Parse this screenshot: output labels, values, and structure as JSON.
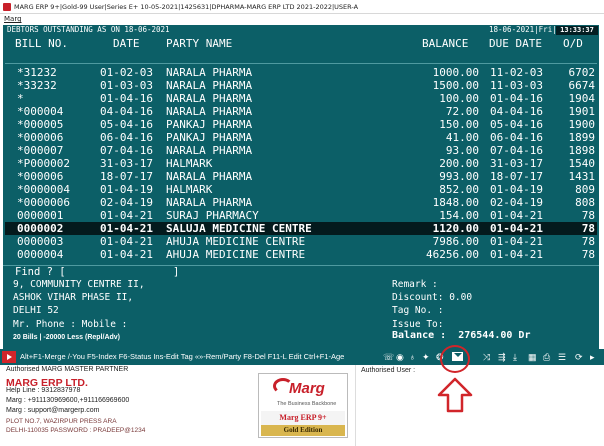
{
  "window": {
    "title": "MARG ERP 9+|Gold-99 User|Series E+ 10-05-2021|1425631|DPHARMA-MARG ERP LTD 2021-2022|USER-A"
  },
  "menu": {
    "item": "Marg"
  },
  "report": {
    "title": "DEBTORS OUTSTANDING AS ON 18-06-2021",
    "date_day": "18-06-2021|Fri|P|",
    "clock": "13:33:37"
  },
  "columns": {
    "bill_no": "BILL NO.",
    "date": "DATE",
    "party": "PARTY NAME",
    "balance": "BALANCE",
    "due_date": "DUE DATE",
    "od": "O/D"
  },
  "rows": [
    {
      "bill": "*31232",
      "date": "01-02-03",
      "party": "NARALA PHARMA",
      "balance": "1000.00",
      "due": "11-02-03",
      "od": "6702"
    },
    {
      "bill": "*33232",
      "date": "01-03-03",
      "party": "NARALA PHARMA",
      "balance": "1500.00",
      "due": "11-03-03",
      "od": "6674"
    },
    {
      "bill": "*",
      "date": "01-04-16",
      "party": "NARALA PHARMA",
      "balance": "100.00",
      "due": "01-04-16",
      "od": "1904"
    },
    {
      "bill": "*000004",
      "date": "04-04-16",
      "party": "NARALA PHARMA",
      "balance": "72.00",
      "due": "04-04-16",
      "od": "1901"
    },
    {
      "bill": "*000005",
      "date": "05-04-16",
      "party": "PANKAJ PHARMA",
      "balance": "150.00",
      "due": "05-04-16",
      "od": "1900"
    },
    {
      "bill": "*000006",
      "date": "06-04-16",
      "party": "PANKAJ PHARMA",
      "balance": "41.00",
      "due": "06-04-16",
      "od": "1899"
    },
    {
      "bill": "*000007",
      "date": "07-04-16",
      "party": "NARALA PHARMA",
      "balance": "93.00",
      "due": "07-04-16",
      "od": "1898"
    },
    {
      "bill": "*P000002",
      "date": "31-03-17",
      "party": "HALMARK",
      "balance": "200.00",
      "due": "31-03-17",
      "od": "1540"
    },
    {
      "bill": "*000006",
      "date": "18-07-17",
      "party": "NARALA PHARMA",
      "balance": "993.00",
      "due": "18-07-17",
      "od": "1431"
    },
    {
      "bill": "*0000004",
      "date": "01-04-19",
      "party": "HALMARK",
      "balance": "852.00",
      "due": "01-04-19",
      "od": "809"
    },
    {
      "bill": "*0000006",
      "date": "02-04-19",
      "party": "NARALA PHARMA",
      "balance": "1848.00",
      "due": "02-04-19",
      "od": "808"
    },
    {
      "bill": "0000001",
      "date": "01-04-21",
      "party": "SURAJ PHARMACY",
      "balance": "154.00",
      "due": "01-04-21",
      "od": "78"
    },
    {
      "bill": "0000002",
      "date": "01-04-21",
      "party": "SALUJA MEDICINE CENTRE",
      "balance": "1120.00",
      "due": "01-04-21",
      "od": "78"
    },
    {
      "bill": "0000003",
      "date": "01-04-21",
      "party": "AHUJA MEDICINE CENTRE",
      "balance": "7986.00",
      "due": "01-04-21",
      "od": "78"
    },
    {
      "bill": "0000004",
      "date": "01-04-21",
      "party": "AHUJA MEDICINE CENTRE",
      "balance": "46256.00",
      "due": "01-04-21",
      "od": "78"
    }
  ],
  "find": {
    "label": "Find ? [",
    "close": "]"
  },
  "address": {
    "line1": "9, COMMUNITY CENTRE II,",
    "line2": "ASHOK VIHAR PHASE II,",
    "line3": "DELHI 52",
    "phone": "Mr.  Phone :  Mobile :"
  },
  "details": {
    "remark": "Remark  :",
    "discount": "Discount: 0.00",
    "tag_no": "Tag No. :",
    "issue_to": "Issue To:"
  },
  "summary": {
    "bills": "20 Bills | -20000 Less (Repl/Adv)",
    "balance_label": "Balance :",
    "balance_value": "276544.00 Dr"
  },
  "shortcut_bar": {
    "text": "Alt+F1-Merge /-You F5-Index F6-Status Ins-Edit Tag «»-Rem/Party F8-Del F11-L Edit Ctrl+F1-Age"
  },
  "footer": {
    "partner": "Authorised MARG MASTER PARTNER",
    "company": "MARG ERP LTD.",
    "helpline": "Help Line : 9312837978",
    "marg_phone": "Marg : +911130969600,+911166969600",
    "marg_email": "Marg : support@margerp.com",
    "plot": "PLOT NO.7, WAZIRPUR PRESS ARA",
    "password": "DELHI-110035 PASSWORD : PRADEEP@1234",
    "authorised_user": "Authorised User :",
    "logo_word": "Marg",
    "logo_tagline": "The Business Backbone",
    "logo_product": "Marg ERP 9+",
    "logo_edition": "Gold Edition"
  },
  "colors": {
    "bg": "#0c5f67",
    "selected": "#041a1d",
    "accent": "#c8202a",
    "highlight": "#d1252a"
  }
}
